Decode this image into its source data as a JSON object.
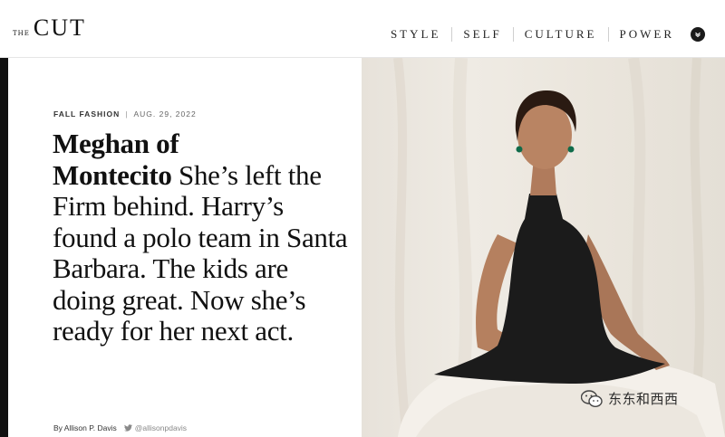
{
  "header": {
    "logo_small": "THE",
    "logo_main": "CUT",
    "nav": [
      "STYLE",
      "SELF",
      "CULTURE",
      "POWER"
    ]
  },
  "article": {
    "section": "FALL FASHION",
    "date": "AUG. 29, 2022",
    "headline_bold_1": "Meghan of",
    "headline_bold_2": "Montecito",
    "headline_rest": " She’s left the Firm behind. Harry’s found a polo team in Santa Barbara. The kids are doing great. Now she’s ready for her next act.",
    "byline": "By Allison P. Davis",
    "twitter_handle": "@allisonpdavis"
  },
  "watermark": {
    "text": "东东和西西"
  },
  "icons": {
    "nav_chevron": "chevron-down-icon",
    "twitter": "twitter-icon",
    "watermark": "wechat-icon"
  },
  "colors": {
    "text": "#111111",
    "left_bar": "#111111",
    "photo_bg": "#ebe6dd",
    "dress": "#1b1b1b",
    "skirt": "#f3efe8"
  }
}
